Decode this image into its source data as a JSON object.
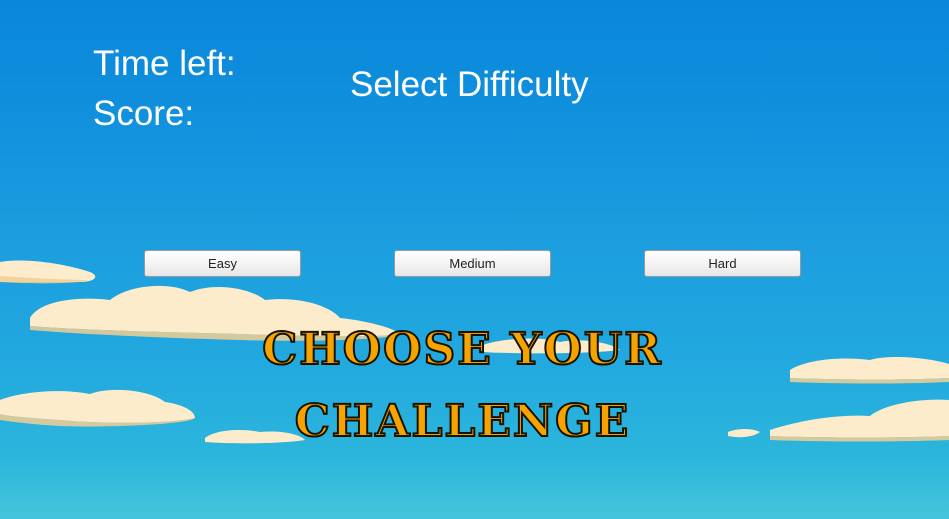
{
  "hud": {
    "time_label": "Time left:",
    "score_label": "Score:"
  },
  "menu": {
    "title": "Select Difficulty",
    "buttons": [
      {
        "label": "Easy"
      },
      {
        "label": "Medium"
      },
      {
        "label": "Hard"
      }
    ]
  },
  "banner": {
    "line1": "CHOOSE YOUR",
    "line2": "CHALLENGE"
  },
  "colors": {
    "sky_top": "#0a86db",
    "sky_bottom": "#45c5dc",
    "banner_fill": "#f6a300",
    "banner_outline": "#1a1200",
    "cloud": "#fbe6c4",
    "hud_text": "#ffffff"
  }
}
